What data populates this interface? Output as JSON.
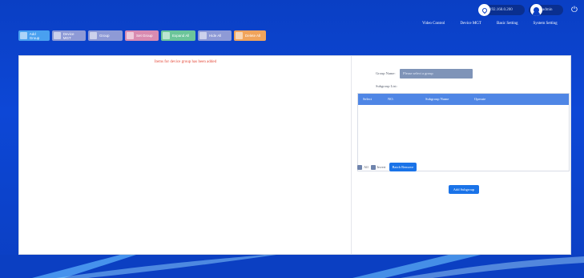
{
  "header": {
    "ip": "192.168.0.200",
    "user": "admin",
    "nav": [
      "Video Control",
      "Device MGT",
      "Basic Setting",
      "System Setting"
    ]
  },
  "toolbar": [
    {
      "label": "Add Group",
      "icon": "add-group-icon"
    },
    {
      "label": "Device MGT",
      "icon": "device-icon"
    },
    {
      "label": "Group",
      "icon": "group-icon"
    },
    {
      "label": "Set Group",
      "icon": "set-group-icon"
    },
    {
      "label": "Expand All",
      "icon": "expand-icon"
    },
    {
      "label": "Hide All",
      "icon": "hide-icon"
    },
    {
      "label": "Delete All",
      "icon": "delete-icon"
    }
  ],
  "left": {
    "notice": "Items for device group has been added"
  },
  "right": {
    "group_name_label": "Group Name:",
    "group_select_placeholder": "Please select a group",
    "subgroup_list_label": "Subgroup List:",
    "columns": [
      "Select",
      "NO.",
      "Subgroup Name",
      "Operate"
    ],
    "all_label": "All",
    "invert_label": "Invert",
    "batch_remove": "Batch Remove",
    "add_subgroup": "Add Subgroup"
  },
  "colors": {
    "accent": "#1a73e8",
    "header_bg": "#0b3fc2",
    "notice": "#e44a3a"
  }
}
